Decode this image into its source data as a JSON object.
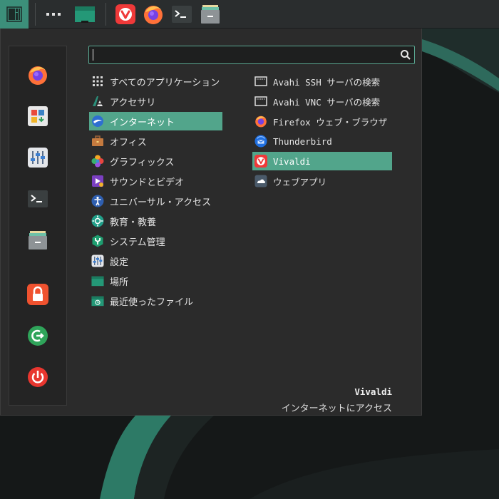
{
  "panel": {
    "buttons": [
      {
        "name": "whisker-menu-button",
        "icon": "manjaro-logo-icon"
      },
      {
        "name": "show-apps-button",
        "icon": "dots-icon"
      },
      {
        "name": "show-desktop-button",
        "icon": "folder-icon"
      },
      {
        "name": "launcher-vivaldi",
        "icon": "vivaldi-icon"
      },
      {
        "name": "launcher-firefox",
        "icon": "firefox-icon"
      },
      {
        "name": "launcher-terminal",
        "icon": "terminal-icon"
      },
      {
        "name": "launcher-file-manager",
        "icon": "file-cabinet-icon"
      }
    ]
  },
  "search": {
    "value": "",
    "placeholder": ""
  },
  "categories": [
    {
      "label": "すべてのアプリケーション",
      "icon": "grid-icon",
      "selected": false
    },
    {
      "label": "アクセサリ",
      "icon": "accessories-icon",
      "selected": false
    },
    {
      "label": "インターネット",
      "icon": "internet-icon",
      "selected": true
    },
    {
      "label": "オフィス",
      "icon": "briefcase-icon",
      "selected": false
    },
    {
      "label": "グラフィックス",
      "icon": "graphics-icon",
      "selected": false
    },
    {
      "label": "サウンドとビデオ",
      "icon": "multimedia-icon",
      "selected": false
    },
    {
      "label": "ユニバーサル・アクセス",
      "icon": "accessibility-icon",
      "selected": false
    },
    {
      "label": "教育・教養",
      "icon": "education-icon",
      "selected": false
    },
    {
      "label": "システム管理",
      "icon": "system-icon",
      "selected": false
    },
    {
      "label": "設定",
      "icon": "settings-icon",
      "selected": false
    },
    {
      "label": "場所",
      "icon": "places-folder-icon",
      "selected": false
    },
    {
      "label": "最近使ったファイル",
      "icon": "recent-files-icon",
      "selected": false
    }
  ],
  "apps": [
    {
      "label": "Avahi SSH サーバの検索",
      "icon": "network-icon",
      "selected": false
    },
    {
      "label": "Avahi VNC サーバの検索",
      "icon": "network-icon",
      "selected": false
    },
    {
      "label": "Firefox ウェブ・ブラウザ",
      "icon": "firefox-icon",
      "selected": false
    },
    {
      "label": "Thunderbird",
      "icon": "thunderbird-icon",
      "selected": false
    },
    {
      "label": "Vivaldi",
      "icon": "vivaldi-icon",
      "selected": true
    },
    {
      "label": "ウェブアプリ",
      "icon": "webapp-icon",
      "selected": false
    }
  ],
  "sidebar": [
    {
      "name": "favorite-firefox",
      "icon": "firefox-icon"
    },
    {
      "name": "favorite-software",
      "icon": "software-store-icon"
    },
    {
      "name": "favorite-settings-manager",
      "icon": "settings-manager-icon"
    },
    {
      "name": "favorite-terminal",
      "icon": "terminal-icon"
    },
    {
      "name": "favorite-file-manager",
      "icon": "file-cabinet-icon"
    },
    {
      "name": "lock-screen-button",
      "icon": "lock-icon"
    },
    {
      "name": "logout-button",
      "icon": "logout-icon"
    },
    {
      "name": "shutdown-button",
      "icon": "power-icon"
    }
  ],
  "description": {
    "title": "Vivaldi",
    "text": "インターネットにアクセス"
  },
  "colors": {
    "accent": "#52a58b",
    "panel": "#2a2d2e",
    "menu_bg": "#2b2b2b",
    "vivaldi": "#ef3939",
    "firefox": "#ff7139"
  }
}
